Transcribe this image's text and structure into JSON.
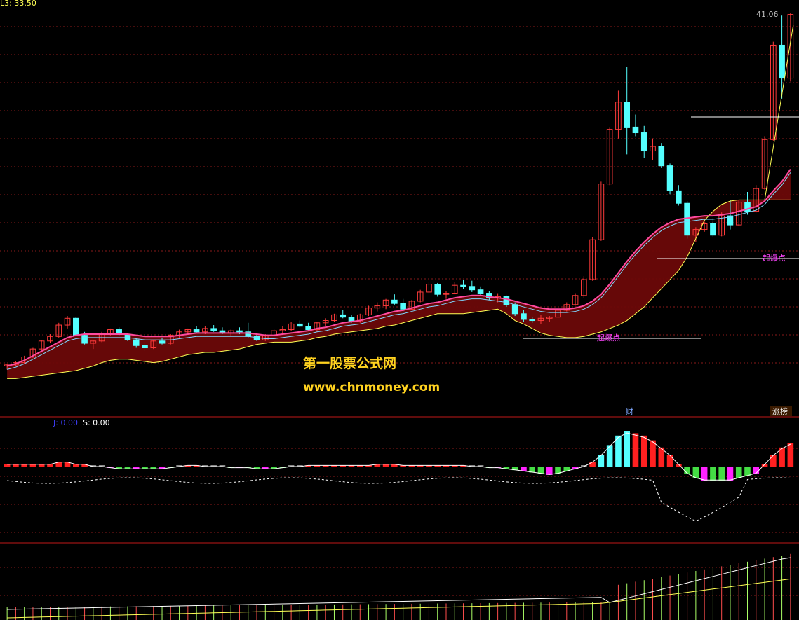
{
  "header": {
    "indicator_text": "L3: 33.50",
    "price_high_label": "41.06"
  },
  "sub_header": {
    "j_text": "J: 0.00",
    "s_text": "S: 0.00"
  },
  "tags": {
    "cai": "财",
    "zhangting": "涨榜"
  },
  "watermark": {
    "line1": "第一股票公式网",
    "line2": "www.chnmoney.com"
  },
  "markers": {
    "qibaodian": "起爆点"
  },
  "colors": {
    "up": "#ff3b3b",
    "down": "#54ffff",
    "grid": "#8a1a1a",
    "divider": "#c01818",
    "band_fill": "#6b0808",
    "pink_line": "#ff4aa0",
    "yellow_line": "#ffff55",
    "cyan_line": "#7fd7ff",
    "watermark": "#ffd21f"
  },
  "chart_data": {
    "type": "candlestick",
    "ylim": [
      8,
      41.06
    ],
    "candles": [
      [
        10.0,
        10.2,
        9.7,
        10.1
      ],
      [
        10.1,
        10.4,
        10.0,
        10.3
      ],
      [
        10.3,
        10.9,
        10.2,
        10.8
      ],
      [
        10.8,
        11.6,
        10.7,
        11.5
      ],
      [
        11.5,
        12.3,
        11.4,
        12.2
      ],
      [
        12.2,
        12.8,
        12.0,
        12.6
      ],
      [
        12.6,
        13.8,
        12.5,
        13.6
      ],
      [
        13.6,
        14.4,
        13.3,
        14.2
      ],
      [
        14.2,
        14.3,
        12.6,
        12.7
      ],
      [
        12.7,
        13.0,
        11.9,
        12.0
      ],
      [
        12.0,
        12.3,
        11.5,
        12.2
      ],
      [
        12.2,
        13.0,
        12.1,
        12.8
      ],
      [
        12.8,
        13.3,
        12.7,
        13.2
      ],
      [
        13.2,
        13.4,
        12.7,
        12.8
      ],
      [
        12.8,
        12.9,
        12.2,
        12.3
      ],
      [
        12.3,
        12.4,
        11.6,
        11.8
      ],
      [
        11.8,
        12.1,
        11.3,
        11.6
      ],
      [
        11.6,
        12.3,
        11.5,
        12.2
      ],
      [
        12.2,
        12.5,
        11.9,
        12.0
      ],
      [
        12.0,
        12.8,
        11.9,
        12.7
      ],
      [
        12.7,
        13.2,
        12.5,
        13.0
      ],
      [
        13.0,
        13.3,
        12.8,
        13.2
      ],
      [
        13.2,
        13.5,
        12.9,
        13.0
      ],
      [
        13.0,
        13.5,
        12.8,
        13.3
      ],
      [
        13.3,
        13.6,
        13.0,
        13.1
      ],
      [
        13.1,
        13.4,
        12.8,
        12.9
      ],
      [
        12.9,
        13.2,
        12.6,
        13.1
      ],
      [
        13.1,
        13.4,
        12.8,
        13.0
      ],
      [
        13.0,
        13.8,
        12.5,
        12.6
      ],
      [
        12.6,
        12.9,
        12.2,
        12.3
      ],
      [
        12.3,
        12.8,
        12.2,
        12.7
      ],
      [
        12.7,
        13.3,
        12.6,
        13.1
      ],
      [
        13.1,
        13.5,
        12.9,
        13.2
      ],
      [
        13.2,
        13.9,
        13.1,
        13.7
      ],
      [
        13.7,
        14.0,
        13.4,
        13.5
      ],
      [
        13.5,
        13.8,
        13.1,
        13.2
      ],
      [
        13.2,
        13.9,
        13.0,
        13.8
      ],
      [
        13.8,
        14.2,
        13.5,
        14.0
      ],
      [
        14.0,
        14.6,
        13.9,
        14.5
      ],
      [
        14.5,
        14.9,
        14.2,
        14.3
      ],
      [
        14.3,
        14.5,
        13.8,
        13.9
      ],
      [
        13.9,
        14.6,
        13.8,
        14.5
      ],
      [
        14.5,
        15.3,
        14.4,
        15.1
      ],
      [
        15.1,
        15.6,
        14.8,
        15.3
      ],
      [
        15.3,
        15.9,
        15.0,
        15.8
      ],
      [
        15.8,
        16.3,
        15.4,
        15.5
      ],
      [
        15.5,
        15.9,
        14.8,
        15.0
      ],
      [
        15.0,
        15.8,
        14.9,
        15.7
      ],
      [
        15.7,
        16.7,
        15.6,
        16.5
      ],
      [
        16.5,
        17.4,
        16.4,
        17.2
      ],
      [
        17.2,
        17.3,
        16.1,
        16.3
      ],
      [
        16.3,
        16.6,
        15.9,
        16.4
      ],
      [
        16.4,
        17.4,
        16.3,
        17.1
      ],
      [
        17.1,
        17.6,
        16.8,
        17.0
      ],
      [
        17.0,
        17.5,
        16.5,
        16.7
      ],
      [
        16.7,
        17.0,
        16.2,
        16.4
      ],
      [
        16.4,
        16.6,
        15.8,
        16.0
      ],
      [
        16.0,
        16.4,
        15.6,
        16.1
      ],
      [
        16.1,
        16.2,
        15.2,
        15.4
      ],
      [
        15.4,
        15.6,
        14.4,
        14.6
      ],
      [
        14.6,
        14.9,
        13.9,
        14.1
      ],
      [
        14.1,
        14.3,
        13.8,
        14.0
      ],
      [
        14.0,
        14.5,
        13.7,
        14.2
      ],
      [
        14.2,
        14.4,
        13.9,
        14.3
      ],
      [
        14.3,
        15.1,
        14.2,
        14.9
      ],
      [
        14.9,
        15.6,
        14.8,
        15.4
      ],
      [
        15.4,
        16.4,
        15.3,
        16.2
      ],
      [
        16.2,
        17.9,
        16.0,
        17.6
      ],
      [
        17.6,
        21.3,
        17.5,
        21.1
      ],
      [
        21.1,
        26.2,
        21.0,
        26.0
      ],
      [
        26.0,
        31.0,
        25.9,
        30.8
      ],
      [
        30.8,
        34.2,
        30.0,
        33.2
      ],
      [
        33.2,
        36.3,
        28.6,
        31.0
      ],
      [
        31.0,
        32.1,
        30.2,
        30.5
      ],
      [
        30.5,
        31.1,
        28.3,
        28.9
      ],
      [
        28.9,
        30.0,
        28.1,
        29.3
      ],
      [
        29.3,
        29.6,
        27.4,
        27.6
      ],
      [
        27.6,
        27.8,
        25.1,
        25.4
      ],
      [
        25.4,
        25.9,
        24.1,
        24.3
      ],
      [
        24.3,
        24.5,
        21.2,
        21.5
      ],
      [
        21.5,
        22.2,
        20.9,
        22.0
      ],
      [
        22.0,
        22.7,
        21.8,
        22.5
      ],
      [
        22.5,
        23.0,
        21.3,
        21.5
      ],
      [
        21.5,
        23.5,
        21.4,
        23.2
      ],
      [
        23.2,
        24.6,
        22.0,
        22.4
      ],
      [
        22.4,
        24.6,
        22.3,
        24.4
      ],
      [
        24.4,
        25.3,
        23.3,
        23.6
      ],
      [
        23.6,
        25.9,
        23.5,
        25.6
      ],
      [
        25.6,
        30.2,
        25.5,
        29.9
      ],
      [
        29.9,
        38.5,
        29.8,
        38.2
      ],
      [
        38.2,
        40.8,
        33.5,
        35.3
      ],
      [
        35.3,
        41.06,
        35.0,
        40.9
      ]
    ],
    "ma_pink": [
      10.0,
      10.2,
      10.5,
      10.9,
      11.3,
      11.7,
      12.1,
      12.5,
      12.7,
      12.8,
      12.8,
      12.8,
      12.8,
      12.8,
      12.8,
      12.7,
      12.6,
      12.6,
      12.6,
      12.6,
      12.7,
      12.8,
      12.9,
      12.9,
      12.9,
      12.9,
      12.9,
      12.9,
      12.9,
      12.8,
      12.7,
      12.7,
      12.8,
      12.9,
      13.0,
      13.1,
      13.3,
      13.4,
      13.6,
      13.8,
      13.9,
      14.0,
      14.2,
      14.4,
      14.6,
      14.8,
      14.9,
      15.1,
      15.3,
      15.5,
      15.6,
      15.8,
      16.0,
      16.1,
      16.2,
      16.2,
      16.1,
      16.0,
      15.9,
      15.7,
      15.5,
      15.3,
      15.1,
      15.0,
      15.0,
      15.0,
      15.1,
      15.3,
      15.7,
      16.3,
      17.2,
      18.2,
      19.2,
      20.1,
      20.9,
      21.6,
      22.2,
      22.6,
      22.9,
      23.0,
      23.1,
      23.2,
      23.2,
      23.3,
      23.4,
      23.6,
      23.8,
      24.0,
      24.5,
      25.4,
      26.2,
      27.3
    ],
    "lower_band": [
      8.9,
      8.9,
      9.0,
      9.1,
      9.2,
      9.3,
      9.4,
      9.5,
      9.6,
      9.8,
      10.0,
      10.3,
      10.5,
      10.6,
      10.6,
      10.5,
      10.4,
      10.3,
      10.4,
      10.6,
      10.8,
      11.0,
      11.1,
      11.2,
      11.2,
      11.3,
      11.4,
      11.5,
      11.7,
      11.9,
      12.0,
      12.1,
      12.1,
      12.1,
      12.2,
      12.3,
      12.5,
      12.6,
      12.8,
      12.9,
      13.0,
      13.1,
      13.2,
      13.3,
      13.5,
      13.6,
      13.8,
      14.0,
      14.2,
      14.4,
      14.6,
      14.6,
      14.6,
      14.6,
      14.7,
      14.8,
      14.9,
      15.0,
      14.6,
      14.0,
      13.7,
      13.3,
      12.9,
      12.7,
      12.6,
      12.5,
      12.5,
      12.6,
      12.8,
      13.0,
      13.3,
      13.6,
      14.0,
      14.6,
      15.2,
      16.0,
      16.8,
      17.6,
      18.4,
      19.6,
      21.2,
      22.8,
      23.6,
      24.2,
      24.5,
      24.6,
      24.6,
      24.6,
      24.6,
      24.6,
      24.6,
      24.6
    ]
  },
  "sub_chart_data": {
    "type": "histogram",
    "bars": [
      1,
      1,
      1,
      1,
      1,
      1,
      2,
      2,
      1,
      1,
      0,
      0,
      -0.5,
      -1,
      -1,
      -1,
      -1,
      -1,
      -1,
      -0.5,
      0,
      0.5,
      0.5,
      0,
      0,
      0,
      -0.5,
      -0.5,
      -0.5,
      -1,
      -1,
      -1,
      -0.5,
      0,
      0,
      0.5,
      0.5,
      0.5,
      0.5,
      0.5,
      0.5,
      0.5,
      0.5,
      1,
      1,
      1,
      0.5,
      0.5,
      0.5,
      0.5,
      0.5,
      0.5,
      0.5,
      0.5,
      0,
      0,
      -0.5,
      -0.5,
      -1,
      -1.5,
      -2,
      -2.5,
      -3,
      -3.5,
      -3,
      -2,
      -1,
      0,
      2,
      5,
      9,
      13,
      15,
      14,
      13,
      11,
      8,
      5,
      1,
      -3,
      -5,
      -6,
      -6,
      -6,
      -6,
      -5,
      -4,
      -3,
      1,
      5,
      8,
      10
    ]
  }
}
